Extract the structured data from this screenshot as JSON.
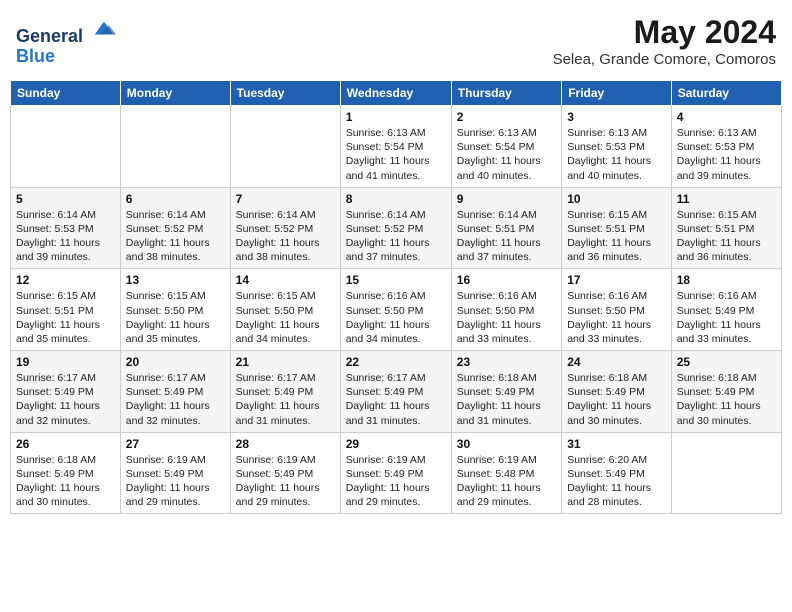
{
  "logo": {
    "general": "General",
    "blue": "Blue"
  },
  "header": {
    "title": "May 2024",
    "subtitle": "Selea, Grande Comore, Comoros"
  },
  "weekdays": [
    "Sunday",
    "Monday",
    "Tuesday",
    "Wednesday",
    "Thursday",
    "Friday",
    "Saturday"
  ],
  "weeks": [
    [
      {
        "day": "",
        "info": ""
      },
      {
        "day": "",
        "info": ""
      },
      {
        "day": "",
        "info": ""
      },
      {
        "day": "1",
        "info": "Sunrise: 6:13 AM\nSunset: 5:54 PM\nDaylight: 11 hours and 41 minutes."
      },
      {
        "day": "2",
        "info": "Sunrise: 6:13 AM\nSunset: 5:54 PM\nDaylight: 11 hours and 40 minutes."
      },
      {
        "day": "3",
        "info": "Sunrise: 6:13 AM\nSunset: 5:53 PM\nDaylight: 11 hours and 40 minutes."
      },
      {
        "day": "4",
        "info": "Sunrise: 6:13 AM\nSunset: 5:53 PM\nDaylight: 11 hours and 39 minutes."
      }
    ],
    [
      {
        "day": "5",
        "info": "Sunrise: 6:14 AM\nSunset: 5:53 PM\nDaylight: 11 hours and 39 minutes."
      },
      {
        "day": "6",
        "info": "Sunrise: 6:14 AM\nSunset: 5:52 PM\nDaylight: 11 hours and 38 minutes."
      },
      {
        "day": "7",
        "info": "Sunrise: 6:14 AM\nSunset: 5:52 PM\nDaylight: 11 hours and 38 minutes."
      },
      {
        "day": "8",
        "info": "Sunrise: 6:14 AM\nSunset: 5:52 PM\nDaylight: 11 hours and 37 minutes."
      },
      {
        "day": "9",
        "info": "Sunrise: 6:14 AM\nSunset: 5:51 PM\nDaylight: 11 hours and 37 minutes."
      },
      {
        "day": "10",
        "info": "Sunrise: 6:15 AM\nSunset: 5:51 PM\nDaylight: 11 hours and 36 minutes."
      },
      {
        "day": "11",
        "info": "Sunrise: 6:15 AM\nSunset: 5:51 PM\nDaylight: 11 hours and 36 minutes."
      }
    ],
    [
      {
        "day": "12",
        "info": "Sunrise: 6:15 AM\nSunset: 5:51 PM\nDaylight: 11 hours and 35 minutes."
      },
      {
        "day": "13",
        "info": "Sunrise: 6:15 AM\nSunset: 5:50 PM\nDaylight: 11 hours and 35 minutes."
      },
      {
        "day": "14",
        "info": "Sunrise: 6:15 AM\nSunset: 5:50 PM\nDaylight: 11 hours and 34 minutes."
      },
      {
        "day": "15",
        "info": "Sunrise: 6:16 AM\nSunset: 5:50 PM\nDaylight: 11 hours and 34 minutes."
      },
      {
        "day": "16",
        "info": "Sunrise: 6:16 AM\nSunset: 5:50 PM\nDaylight: 11 hours and 33 minutes."
      },
      {
        "day": "17",
        "info": "Sunrise: 6:16 AM\nSunset: 5:50 PM\nDaylight: 11 hours and 33 minutes."
      },
      {
        "day": "18",
        "info": "Sunrise: 6:16 AM\nSunset: 5:49 PM\nDaylight: 11 hours and 33 minutes."
      }
    ],
    [
      {
        "day": "19",
        "info": "Sunrise: 6:17 AM\nSunset: 5:49 PM\nDaylight: 11 hours and 32 minutes."
      },
      {
        "day": "20",
        "info": "Sunrise: 6:17 AM\nSunset: 5:49 PM\nDaylight: 11 hours and 32 minutes."
      },
      {
        "day": "21",
        "info": "Sunrise: 6:17 AM\nSunset: 5:49 PM\nDaylight: 11 hours and 31 minutes."
      },
      {
        "day": "22",
        "info": "Sunrise: 6:17 AM\nSunset: 5:49 PM\nDaylight: 11 hours and 31 minutes."
      },
      {
        "day": "23",
        "info": "Sunrise: 6:18 AM\nSunset: 5:49 PM\nDaylight: 11 hours and 31 minutes."
      },
      {
        "day": "24",
        "info": "Sunrise: 6:18 AM\nSunset: 5:49 PM\nDaylight: 11 hours and 30 minutes."
      },
      {
        "day": "25",
        "info": "Sunrise: 6:18 AM\nSunset: 5:49 PM\nDaylight: 11 hours and 30 minutes."
      }
    ],
    [
      {
        "day": "26",
        "info": "Sunrise: 6:18 AM\nSunset: 5:49 PM\nDaylight: 11 hours and 30 minutes."
      },
      {
        "day": "27",
        "info": "Sunrise: 6:19 AM\nSunset: 5:49 PM\nDaylight: 11 hours and 29 minutes."
      },
      {
        "day": "28",
        "info": "Sunrise: 6:19 AM\nSunset: 5:49 PM\nDaylight: 11 hours and 29 minutes."
      },
      {
        "day": "29",
        "info": "Sunrise: 6:19 AM\nSunset: 5:49 PM\nDaylight: 11 hours and 29 minutes."
      },
      {
        "day": "30",
        "info": "Sunrise: 6:19 AM\nSunset: 5:48 PM\nDaylight: 11 hours and 29 minutes."
      },
      {
        "day": "31",
        "info": "Sunrise: 6:20 AM\nSunset: 5:49 PM\nDaylight: 11 hours and 28 minutes."
      },
      {
        "day": "",
        "info": ""
      }
    ]
  ]
}
